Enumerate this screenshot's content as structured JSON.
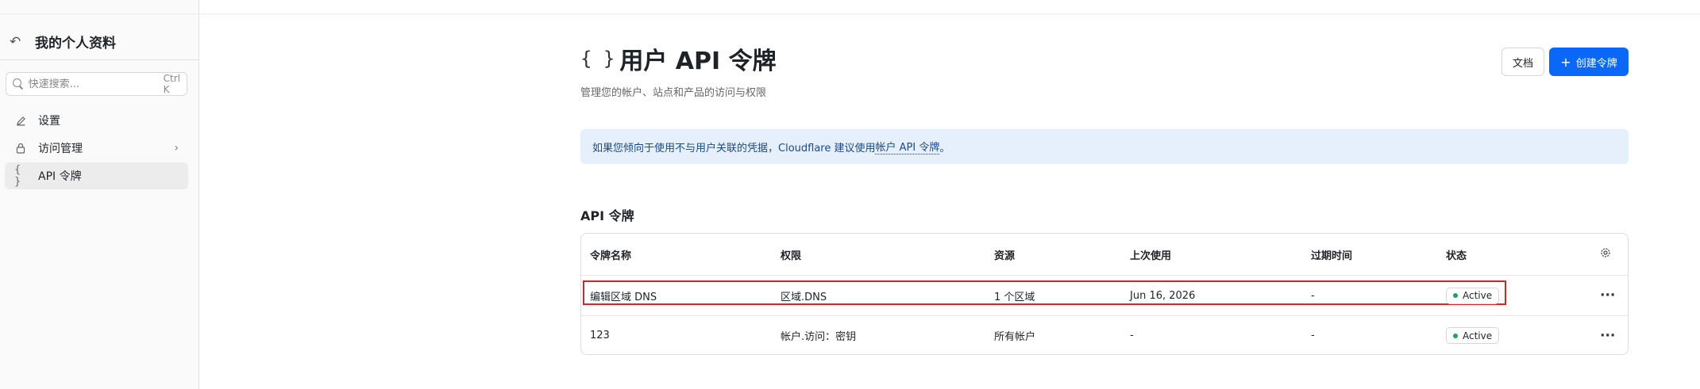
{
  "sidebar": {
    "title": "我的个人资料",
    "back_icon": "undo-arrow-icon",
    "search_placeholder": "快速搜索...",
    "search_shortcut": "Ctrl K",
    "items": [
      {
        "label": "设置",
        "icon": "pencil-icon",
        "active": false
      },
      {
        "label": "访问管理",
        "icon": "lock-icon",
        "active": false,
        "has_chevron": true
      },
      {
        "label": "API 令牌",
        "icon": "braces-icon",
        "active": true
      }
    ]
  },
  "header": {
    "braces": "{ }",
    "title": "用户 API 令牌",
    "subtitle": "管理您的帐户、站点和产品的访问与权限",
    "docs_label": "文档",
    "create_label": "创建令牌"
  },
  "banner": {
    "text_before": "如果您倾向于使用不与用户关联的凭据，Cloudflare 建议使用",
    "link_text": "帐户 API 令牌",
    "text_after": "。"
  },
  "section": {
    "title": "API 令牌"
  },
  "table": {
    "columns": [
      "令牌名称",
      "权限",
      "资源",
      "上次使用",
      "过期时间",
      "状态"
    ],
    "rows": [
      {
        "name": "编辑区域 DNS",
        "permission": "区域.DNS",
        "resource": "1 个区域",
        "last_used": "Jun 16, 2026",
        "expires": "-",
        "status": "Active",
        "highlighted": true
      },
      {
        "name": "123",
        "permission": "帐户.访问：密钥",
        "resource": "所有帐户",
        "last_used": "-",
        "expires": "-",
        "status": "Active",
        "highlighted": false
      }
    ],
    "more_glyph": "···",
    "settings_icon": "gear-icon"
  },
  "colors": {
    "accent": "#0b68f7",
    "banner_bg": "#e5f0fc",
    "status_active": "#22a35a",
    "highlight": "#cc2a2a"
  }
}
